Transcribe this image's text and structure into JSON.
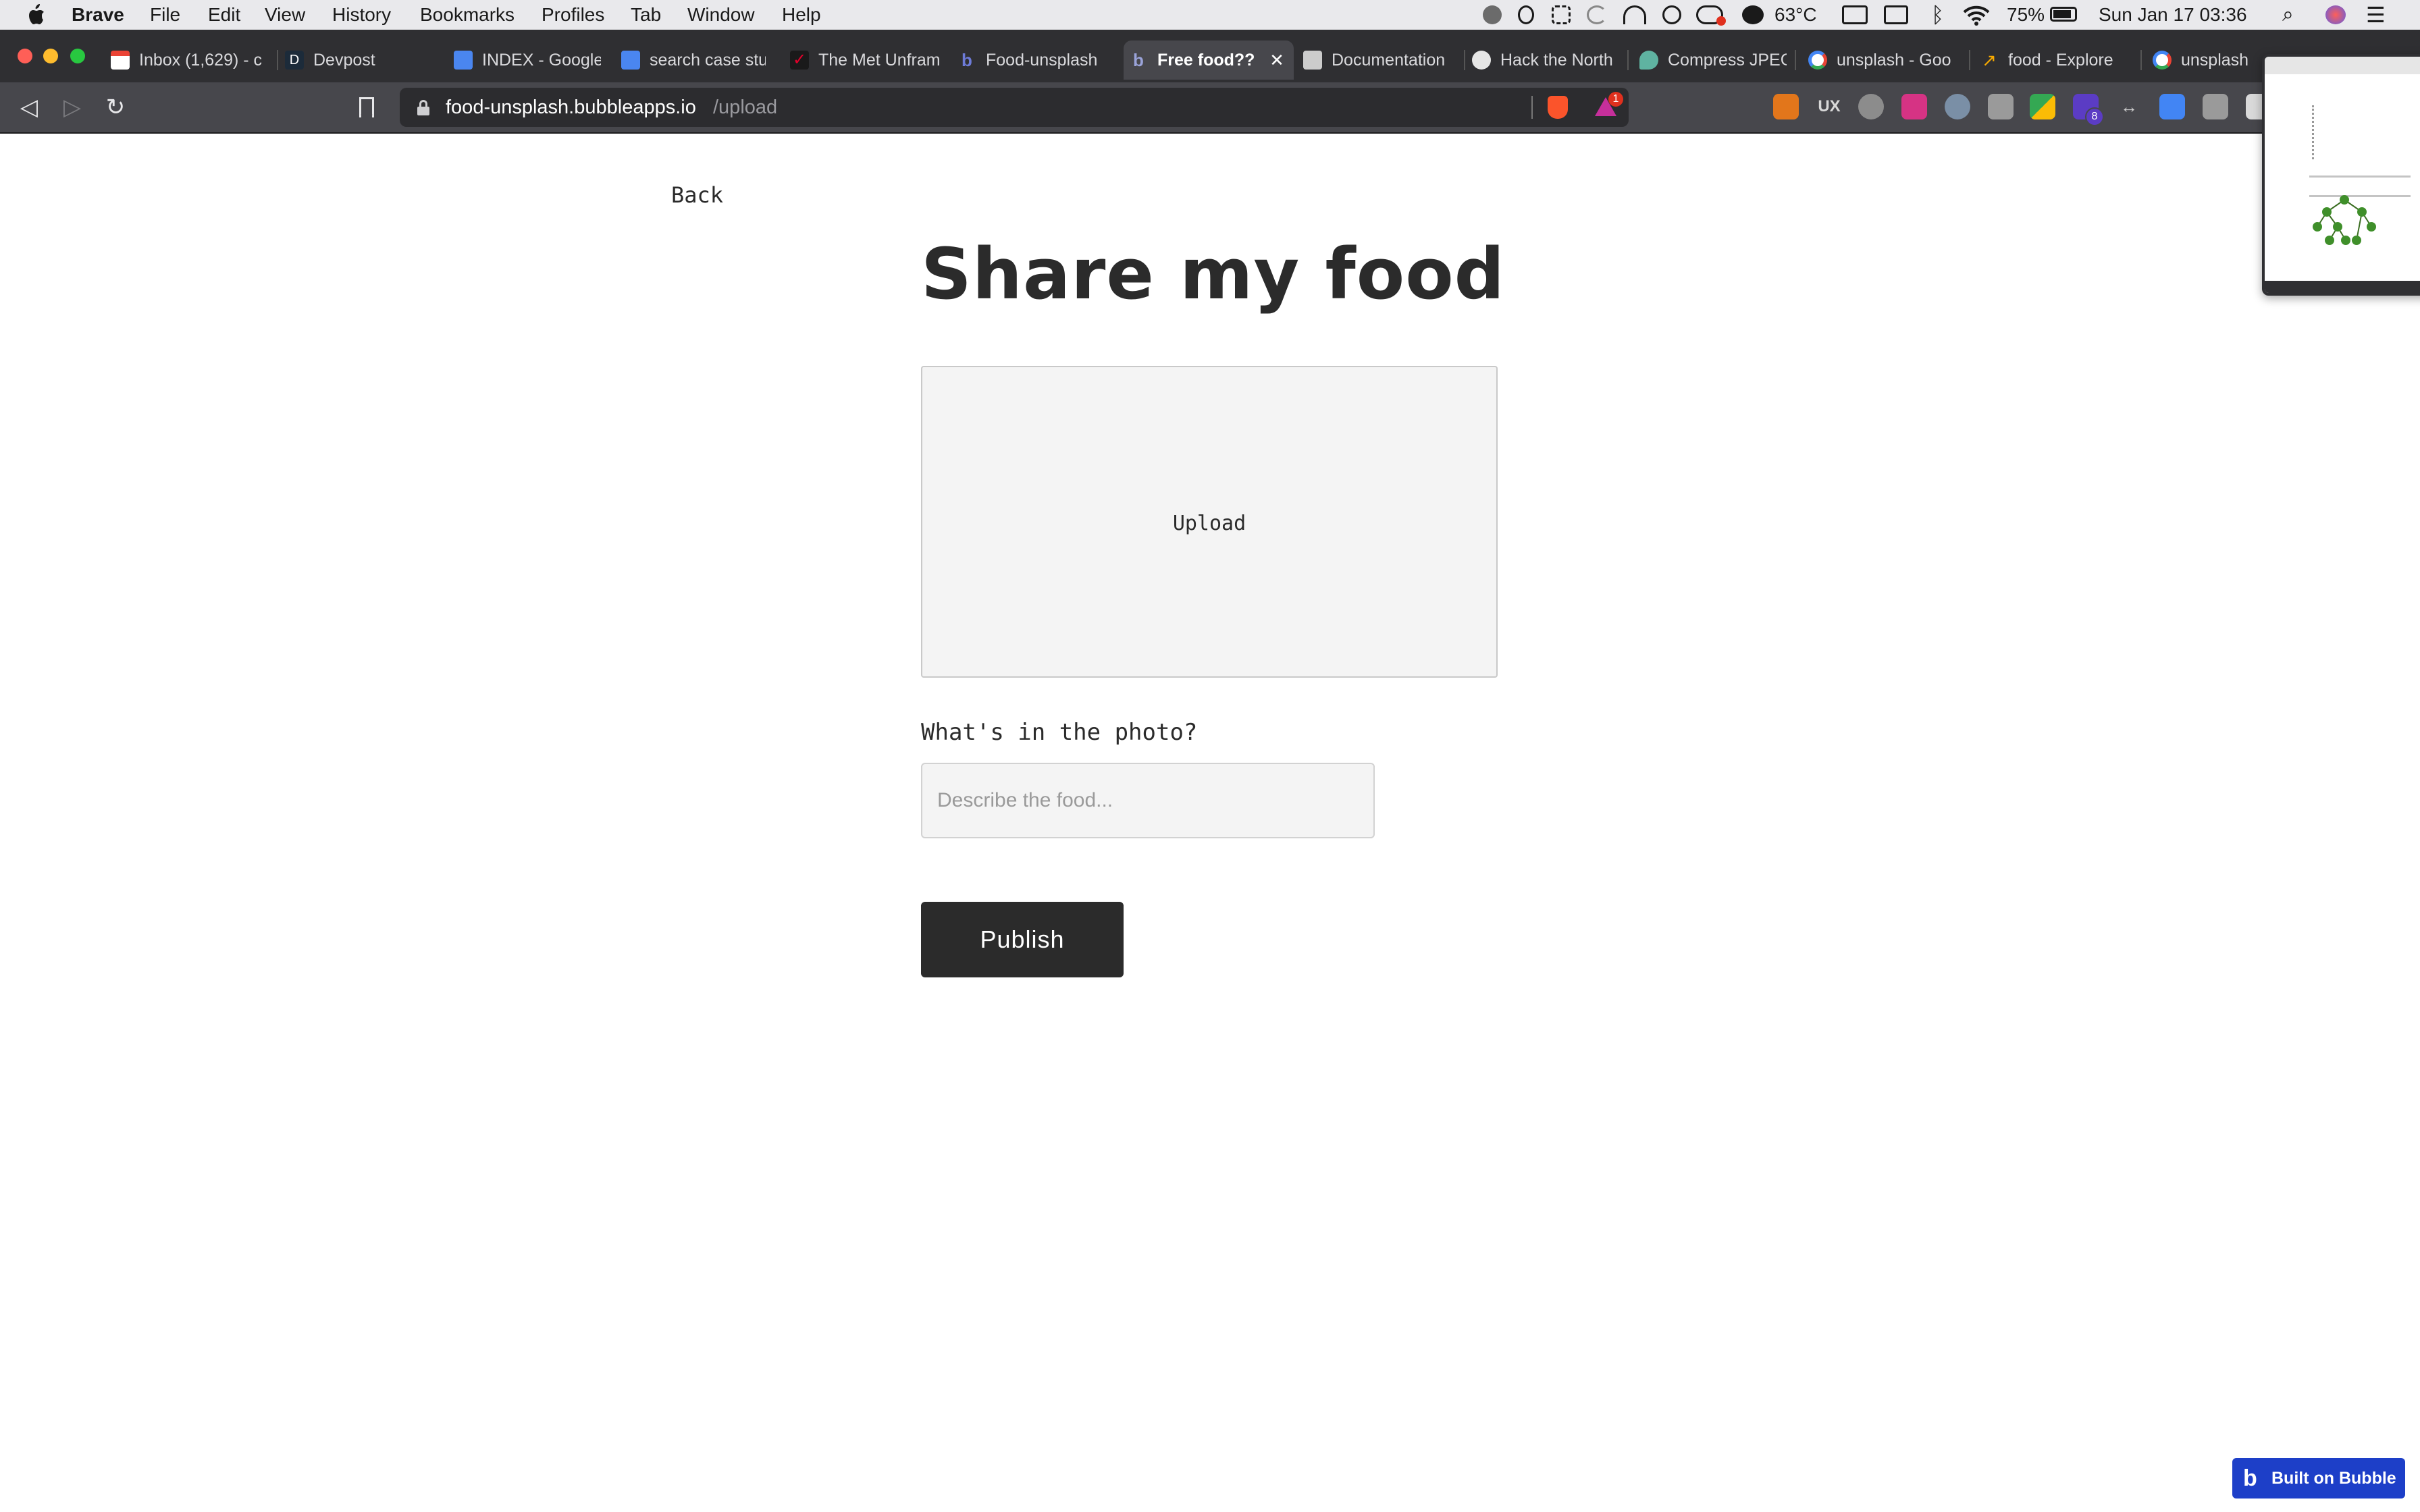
{
  "menubar": {
    "app_name": "Brave",
    "items": [
      "File",
      "Edit",
      "View",
      "History",
      "Bookmarks",
      "Profiles",
      "Tab",
      "Window",
      "Help"
    ],
    "status": {
      "temperature": "63°C",
      "battery": "75%",
      "datetime": "Sun Jan 17  03:36"
    }
  },
  "tabs": [
    {
      "title": "Inbox (1,629) - c",
      "favicon": "gmail-icon",
      "color": "#ea4335"
    },
    {
      "title": "Devpost",
      "favicon": "devpost-icon",
      "color": "#1c2b3a"
    },
    {
      "title": "INDEX - Google",
      "favicon": "google-docs-icon",
      "color": "#4a86f0"
    },
    {
      "title": "search case stu",
      "favicon": "google-docs-icon",
      "color": "#4a86f0"
    },
    {
      "title": "The Met Unfram",
      "favicon": "met-icon",
      "color": "#e4002b"
    },
    {
      "title": "Food-unsplash",
      "favicon": "bubble-icon",
      "color": "#3b5bdb"
    },
    {
      "title": "Free food??",
      "favicon": "bubble-icon",
      "color": "#3b5bdb",
      "active": true
    },
    {
      "title": "Documentation",
      "favicon": "docs-icon",
      "color": "#cccccc"
    },
    {
      "title": "Hack the North",
      "favicon": "hackthenorth-icon",
      "color": "#e6e6e6"
    },
    {
      "title": "Compress JPEG",
      "favicon": "compress-icon",
      "color": "#5fb3a1"
    },
    {
      "title": "unsplash - Goo",
      "favicon": "google-icon",
      "color": "#4285f4"
    },
    {
      "title": "food - Explore",
      "favicon": "trends-icon",
      "color": "#f9ab00"
    },
    {
      "title": "unsplash",
      "favicon": "google-icon",
      "color": "#4285f4"
    }
  ],
  "tab_close_glyph": "✕",
  "address_bar": {
    "host": "food-unsplash.bubbleapps.io",
    "path": "/upload",
    "notification_count": "1"
  },
  "extensions": [
    {
      "name": "metamask-icon",
      "color": "#e2761b"
    },
    {
      "name": "ux-icon",
      "color": "#6b6b6b"
    },
    {
      "name": "gear-extension-icon",
      "color": "#8c8c8c"
    },
    {
      "name": "grid-extension-icon",
      "color": "#d63384"
    },
    {
      "name": "owl-icon",
      "color": "#7a8fa6"
    },
    {
      "name": "camera-icon",
      "color": "#9a9a9a"
    },
    {
      "name": "color-extension-icon",
      "color": "#34a853"
    },
    {
      "name": "hat-extension-icon",
      "color": "#5b3cc4",
      "badge": "8"
    },
    {
      "name": "arrows-extension-icon",
      "color": "#cfcfcf"
    },
    {
      "name": "translate-icon",
      "color": "#4285f4"
    },
    {
      "name": "copy-extension-icon",
      "color": "#9a9a9a"
    },
    {
      "name": "notion-icon",
      "color": "#d9d9d9"
    }
  ],
  "page": {
    "back_label": "Back",
    "title": "Share my food",
    "upload_label": "Upload",
    "field_label": "What's in the photo?",
    "input_placeholder": "Describe the food...",
    "input_value": "",
    "publish_label": "Publish"
  },
  "badge": {
    "label": "Built on Bubble",
    "color": "#1d3fc8"
  },
  "colors": {
    "accent_dark": "#2b2b2b",
    "upload_bg": "#f4f4f4",
    "brave_orange": "#fb542b"
  }
}
